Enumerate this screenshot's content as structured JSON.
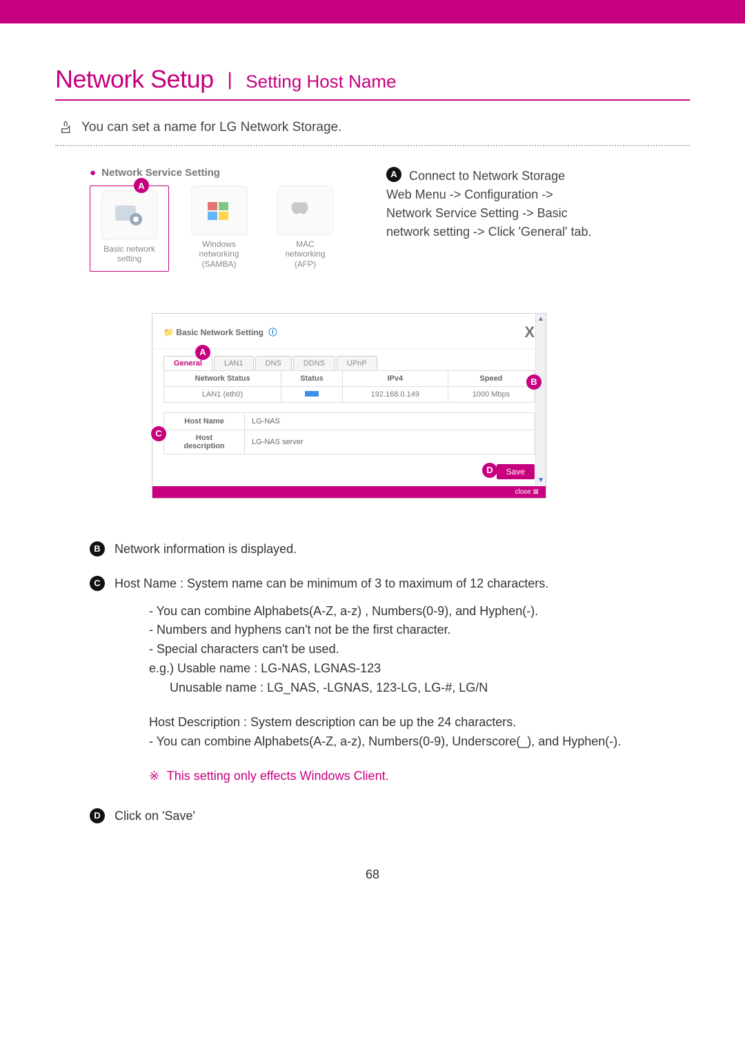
{
  "header": {
    "title_main": "Network Setup",
    "title_sub": "Setting Host Name"
  },
  "intro": "You can set a name for LG Network Storage.",
  "nss": {
    "heading": "Network Service Setting",
    "cards": [
      {
        "label": "Basic network\nsetting"
      },
      {
        "label": "Windows\nnetworking\n(SAMBA)"
      },
      {
        "label": "MAC\nnetworking\n(AFP)"
      }
    ]
  },
  "explain_a": "Connect to Network Storage Web Menu -> Configuration -> Network Service Setting -> Basic network setting -> Click 'General' tab.",
  "lower": {
    "title": "Basic Network Setting",
    "tabs": [
      "General",
      "LAN1",
      "DNS",
      "DDNS",
      "UPnP"
    ],
    "table": {
      "headers": [
        "Network Status",
        "Status",
        "IPv4",
        "Speed"
      ],
      "row": {
        "name": "LAN1 (eth0)",
        "ipv4": "192.168.0.149",
        "speed": "1000 Mbps"
      }
    },
    "host_name_label": "Host Name",
    "host_name_value": "LG-NAS",
    "host_desc_label": "Host\ndescription",
    "host_desc_value": "LG-NAS server",
    "save": "Save",
    "close": "close"
  },
  "notes": {
    "b": "Network information is displayed.",
    "c_lead": "Host Name : System name can be minimum of 3 to maximum of 12 characters.",
    "c_lines": [
      "- You can combine Alphabets(A-Z, a-z) , Numbers(0-9), and Hyphen(-).",
      "- Numbers and hyphens can't not be the first character.",
      "- Special characters can't be used.",
      "e.g.) Usable name : LG-NAS, LGNAS-123",
      "      Unusable name : LG_NAS, -LGNAS, 123-LG, LG-#, LG/N"
    ],
    "host_desc_lead": "Host Description : System description can be up the 24 characters.",
    "host_desc_line": "- You can combine Alphabets(A-Z, a-z), Numbers(0-9), Underscore(_), and Hyphen(-).",
    "warn": "This setting only effects Windows Client.",
    "d": "Click on 'Save'"
  },
  "page_number": "68",
  "callouts": {
    "a": "A",
    "b": "B",
    "c": "C",
    "d": "D"
  }
}
